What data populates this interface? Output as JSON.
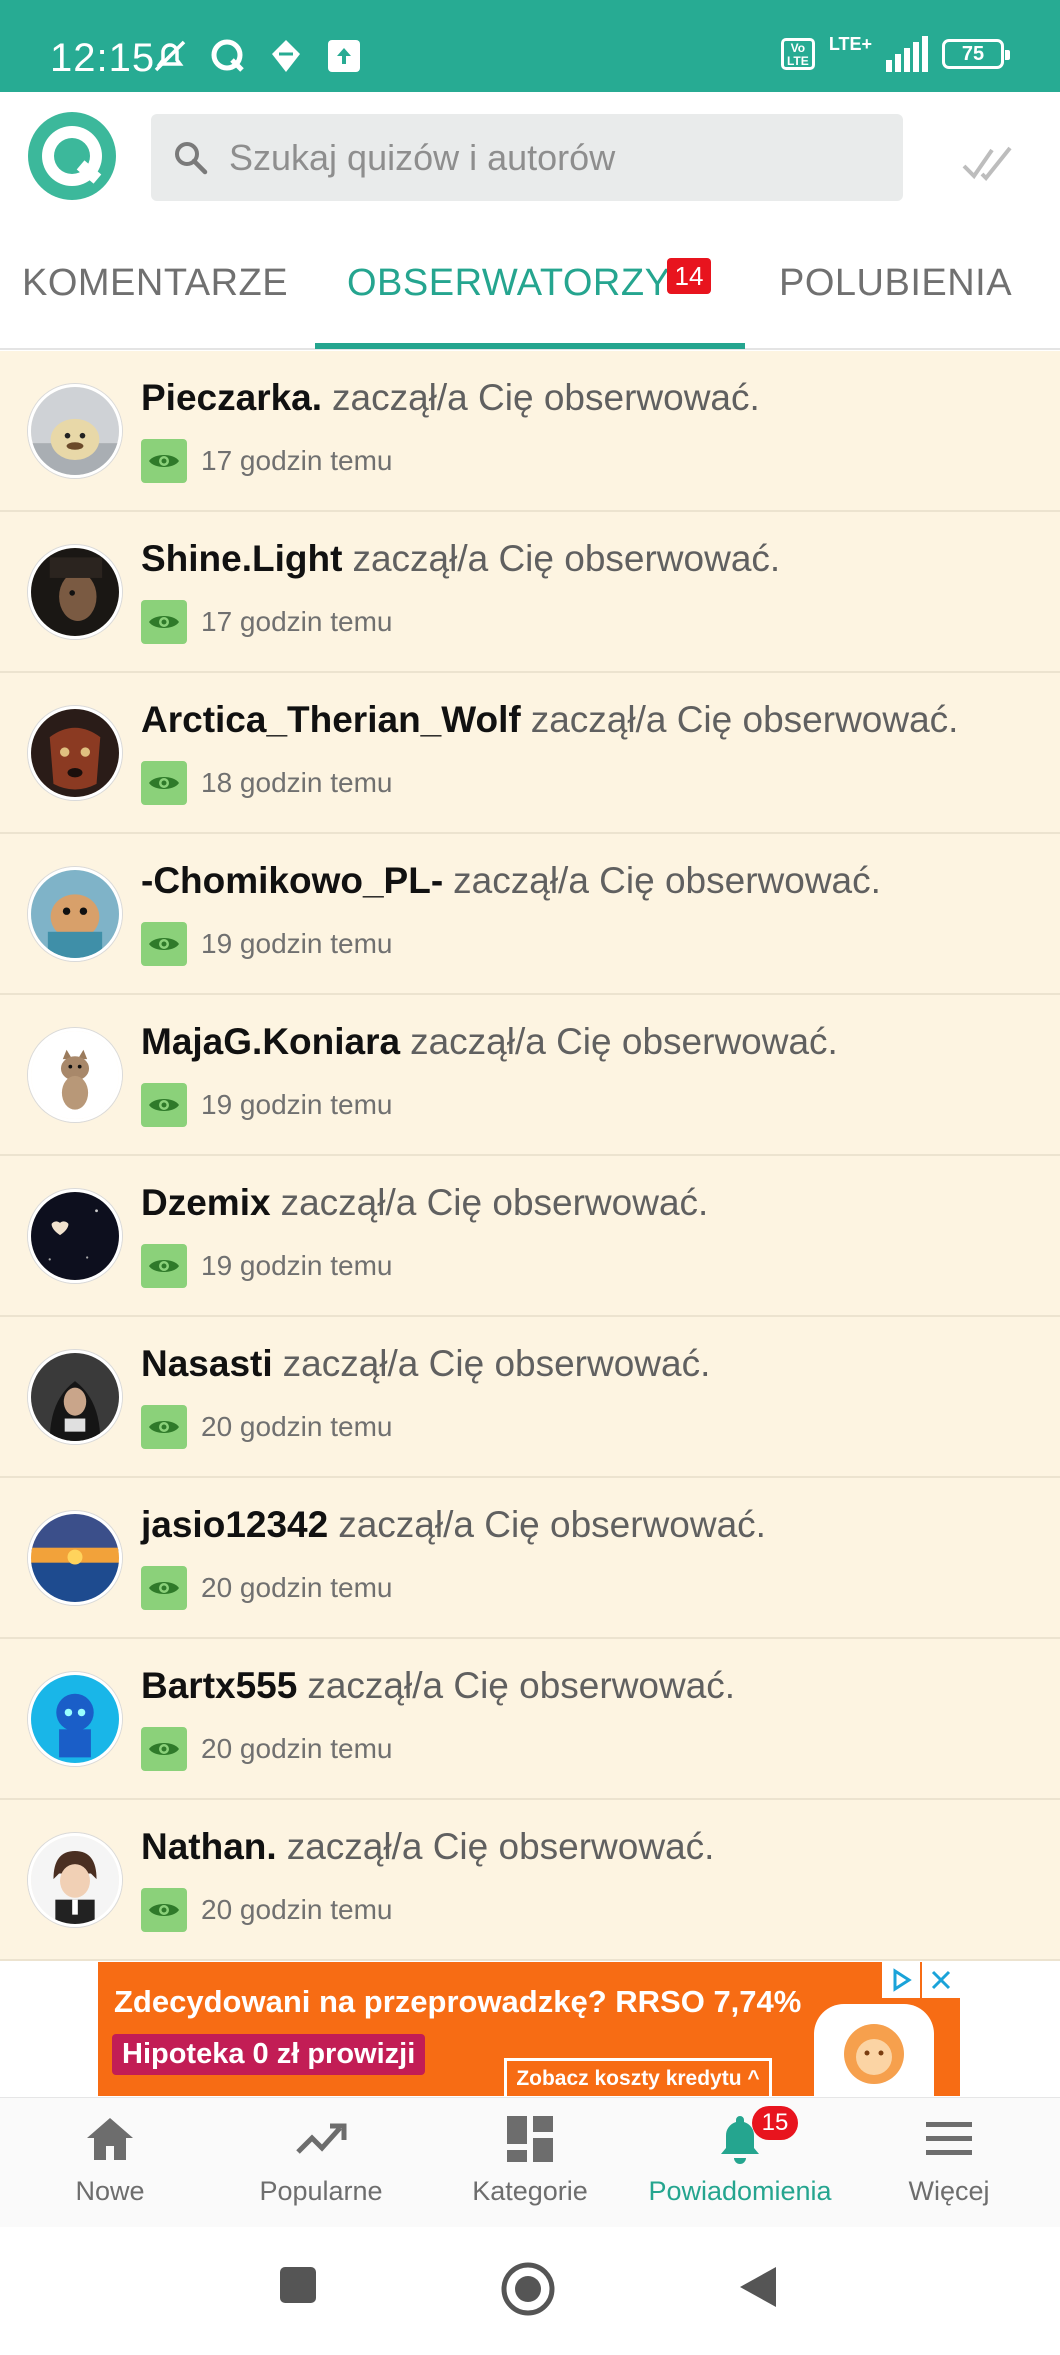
{
  "status_bar": {
    "time": "12:15",
    "volte": "Vo LTE",
    "network": "LTE+",
    "battery": "75"
  },
  "header": {
    "search_placeholder": "Szukaj quizów i autorów"
  },
  "tabs": [
    {
      "label": "KOMENTARZE",
      "active": false
    },
    {
      "label": "OBSERWATORZY",
      "active": true,
      "badge": "14"
    },
    {
      "label": "POLUBIENIA",
      "active": false
    }
  ],
  "notifications": [
    {
      "username": "Pieczarka.",
      "action": "zaczął/a Cię obserwować.",
      "time": "17 godzin temu"
    },
    {
      "username": "Shine.Light",
      "action": "zaczął/a Cię obserwować.",
      "time": "17 godzin temu"
    },
    {
      "username": "Arctica_Therian_Wolf",
      "action": "zaczął/a Cię obserwować.",
      "time": "18 godzin temu"
    },
    {
      "username": "-Chomikowo_PL-",
      "action": "zaczął/a Cię obserwować.",
      "time": "19 godzin temu"
    },
    {
      "username": "MajaG.Koniara",
      "action": "zaczął/a Cię obserwować.",
      "time": "19 godzin temu"
    },
    {
      "username": "Dzemix",
      "action": "zaczął/a Cię obserwować.",
      "time": "19 godzin temu"
    },
    {
      "username": "Nasasti",
      "action": "zaczął/a Cię obserwować.",
      "time": "20 godzin temu"
    },
    {
      "username": "jasio12342",
      "action": "zaczął/a Cię obserwować.",
      "time": "20 godzin temu"
    },
    {
      "username": "Bartx555",
      "action": "zaczął/a Cię obserwować.",
      "time": "20 godzin temu"
    },
    {
      "username": "Nathan.",
      "action": "zaczął/a Cię obserwować.",
      "time": "20 godzin temu"
    }
  ],
  "ad": {
    "headline": "Zdecydowani na przeprowadzkę? RRSO 7,74%",
    "pill": "Hipoteka 0 zł prowizji",
    "cta": "Zobacz koszty kredytu ^"
  },
  "bottom_nav": [
    {
      "label": "Nowe",
      "icon": "home-icon",
      "active": false
    },
    {
      "label": "Popularne",
      "icon": "trending-icon",
      "active": false
    },
    {
      "label": "Kategorie",
      "icon": "grid-icon",
      "active": false
    },
    {
      "label": "Powiadomienia",
      "icon": "bell-icon",
      "active": true,
      "badge": "15"
    },
    {
      "label": "Więcej",
      "icon": "menu-icon",
      "active": false
    }
  ],
  "colors": {
    "accent": "#25a58f",
    "status_bar": "#27ab93",
    "row_bg": "#fdf4e1",
    "badge": "#e8141e",
    "seen": "#8bd17a"
  }
}
